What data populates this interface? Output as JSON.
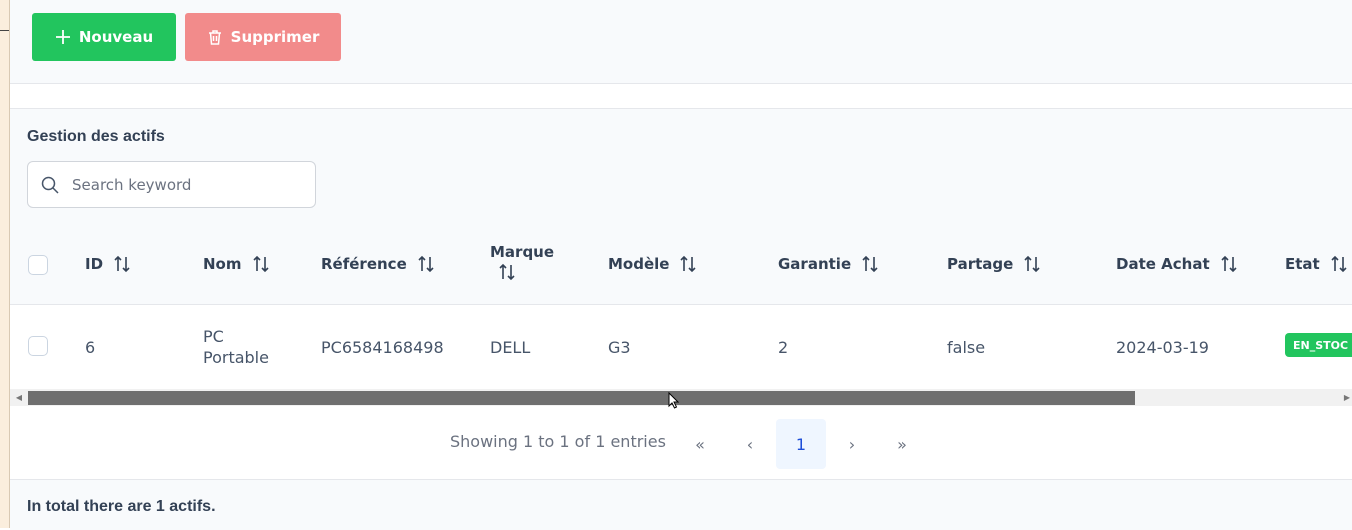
{
  "toolbar": {
    "new_label": "Nouveau",
    "delete_label": "Supprimer"
  },
  "card": {
    "title": "Gestion des actifs",
    "search_placeholder": "Search keyword"
  },
  "table": {
    "columns": [
      "ID",
      "Nom",
      "Référence",
      "Marque",
      "Modèle",
      "Garantie",
      "Partage",
      "Date Achat",
      "Etat"
    ],
    "rows": [
      {
        "id": "6",
        "nom_line1": "PC",
        "nom_line2": "Portable",
        "reference": "PC6584168498",
        "marque": "DELL",
        "modele": "G3",
        "garantie": "2",
        "partage": "false",
        "date_achat": "2024-03-19",
        "etat": "EN_STOC"
      }
    ]
  },
  "pagination": {
    "showing": "Showing 1 to 1 of 1 entries",
    "first": "«",
    "prev": "‹",
    "current": "1",
    "next": "›",
    "last": "»"
  },
  "footer": {
    "summary": "In total there are 1 actifs."
  },
  "colors": {
    "primary_green": "#22c55e",
    "danger_light": "#f28b8b",
    "header_bg": "#f8fafc"
  }
}
